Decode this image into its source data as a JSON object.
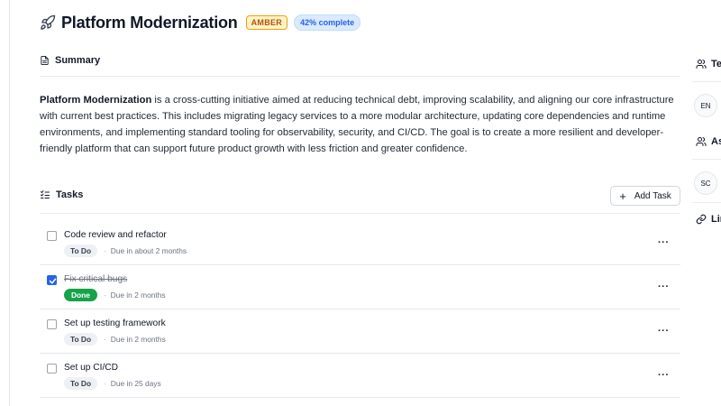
{
  "project": {
    "title": "Platform Modernization",
    "status_badge": "AMBER",
    "progress_label": "42% complete",
    "progress": 0.42
  },
  "summary": {
    "heading": "Summary",
    "bold_name": "Platform Modernization",
    "body": " is a cross-cutting initiative aimed at reducing technical debt, improving scalability, and aligning our core infrastructure with current best practices. This includes migrating legacy services to a more modular architecture, updating core dependencies and runtime environments, and implementing standard tooling for observability, security, and CI/CD. The goal is to create a more resilient and developer-friendly platform that can support future product growth with less friction and greater confidence."
  },
  "tasks": {
    "heading": "Tasks",
    "add_label": "Add Task",
    "separator": "·",
    "more_label": "···",
    "items": [
      {
        "name": "Code review and refactor",
        "status": "To Do",
        "due": "Due in about 2 months",
        "done": false
      },
      {
        "name": "Fix critical bugs",
        "status": "Done",
        "due": "Due in 2 months",
        "done": true
      },
      {
        "name": "Set up testing framework",
        "status": "To Do",
        "due": "Due in 2 months",
        "done": false
      },
      {
        "name": "Set up CI/CD",
        "status": "To Do",
        "due": "Due in 25 days",
        "done": false
      }
    ]
  },
  "sidebar": {
    "team_label": "Te",
    "team_avatar": "EN",
    "assignee_label": "As",
    "assignee_avatar": "SC",
    "links_label": "Lin"
  },
  "colors": {
    "accent": "#2563eb",
    "amber": "#f59e0b",
    "done": "#16a34a"
  }
}
